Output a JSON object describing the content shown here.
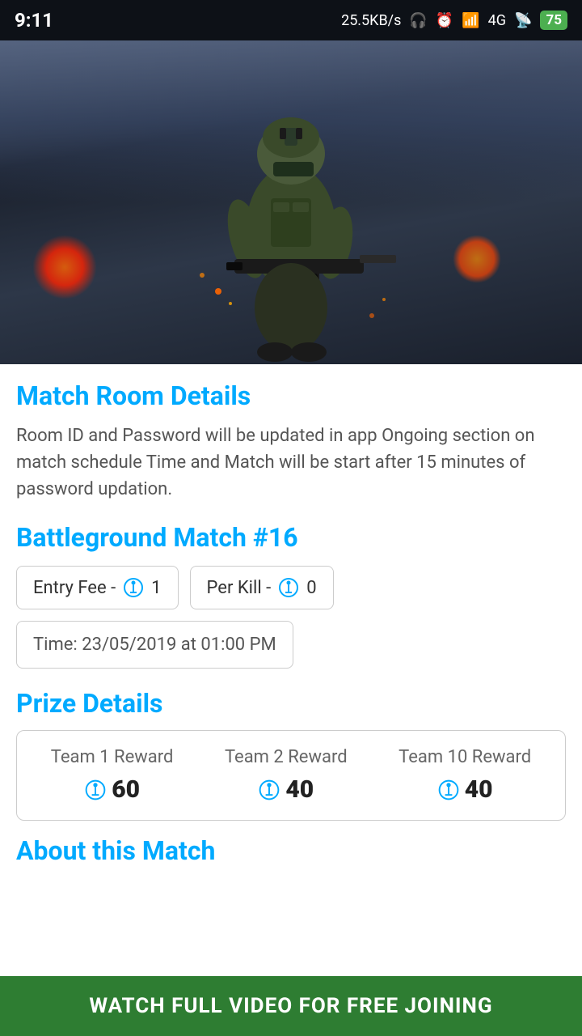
{
  "status_bar": {
    "time": "9:11",
    "network_speed": "25.5KB/s",
    "signal": "4G",
    "battery": "75"
  },
  "hero": {
    "alt": "PUBG soldier with weapon"
  },
  "match_room": {
    "section_title": "Match Room Details",
    "description": "Room ID and Password will be updated in app Ongoing section on match schedule Time and Match will be start after 15 minutes of password updation."
  },
  "match": {
    "title": "Battleground Match #16",
    "entry_fee_label": "Entry Fee -",
    "entry_fee_value": "1",
    "per_kill_label": "Per Kill -",
    "per_kill_value": "0",
    "time_label": "Time:",
    "time_value": "23/05/2019 at 01:00 PM"
  },
  "prize_details": {
    "section_title": "Prize Details",
    "rewards": [
      {
        "label": "Team 1 Reward",
        "amount": "60"
      },
      {
        "label": "Team 2 Reward",
        "amount": "40"
      },
      {
        "label": "Team 10 Reward",
        "amount": "40"
      }
    ]
  },
  "about": {
    "section_title": "About this Match"
  },
  "cta": {
    "label": "WATCH FULL VIDEO FOR FREE JOINING"
  }
}
